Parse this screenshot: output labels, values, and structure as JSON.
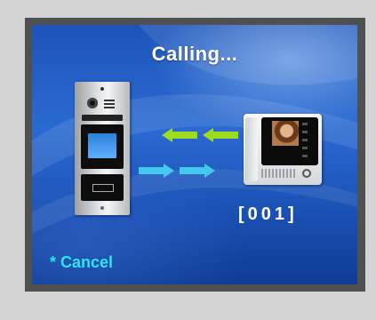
{
  "screen": {
    "title": "Calling...",
    "apartment_code": "[001]",
    "cancel_label": "* Cancel"
  },
  "colors": {
    "background_blue": "#1e54b8",
    "cancel_text": "#2ee6f0",
    "arrow_green": "#9bdc1e",
    "arrow_blue": "#45c8f0"
  },
  "icons": {
    "door_station": "door-station-panel",
    "indoor_monitor": "indoor-monitor",
    "incoming_arrows": "left-arrows",
    "outgoing_arrows": "right-arrows"
  }
}
